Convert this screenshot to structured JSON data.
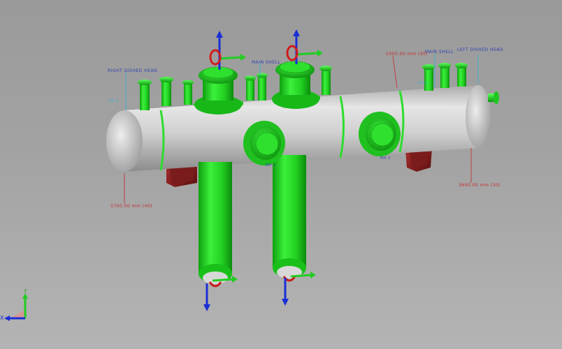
{
  "labels": {
    "right_dished_head": "RIGHT DISHED HEAD",
    "main_shell_1": "MAIN SHELL",
    "main_shell_2": "MAIN SHELL",
    "left_dished_head": "LEFT DISHED HEAD",
    "dim_top": "2000.00 mm (30)",
    "dim_left": "3700.00 mm (40)",
    "dim_right": "3600.00 mm (30)",
    "mh_1": "MH 1",
    "mh_2": "MH 2",
    "lh_right": "LH 2",
    "lh_left": "LH 1"
  },
  "axis_triad": {
    "x": "X",
    "y": "Y"
  },
  "colors": {
    "vessel": "#cfcfcf",
    "nozzle": "#22e022",
    "axis_blue": "#1a2fd6",
    "axis_green": "#22cc22",
    "saddle": "#8a2020",
    "dim_red": "#c8282a",
    "dim_cyan": "#2bb5d8"
  }
}
